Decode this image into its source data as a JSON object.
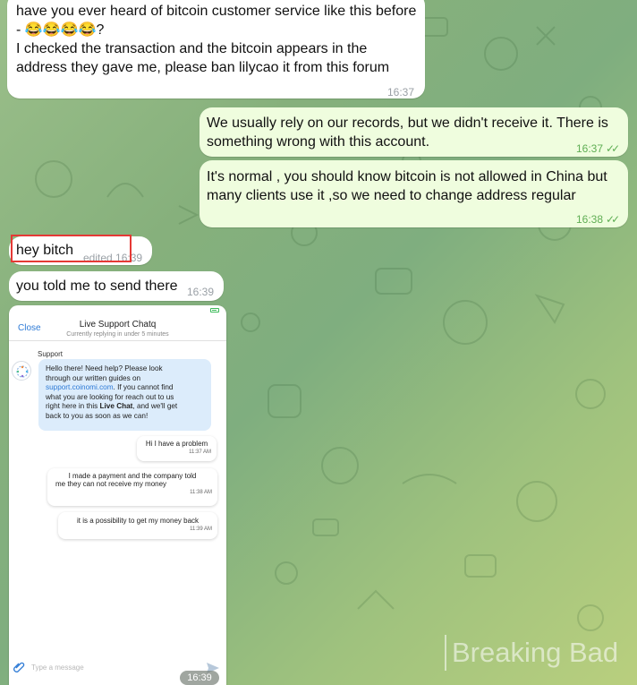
{
  "messages": {
    "first": {
      "line1": "have you ever heard of bitcoin customer service like this before",
      "line2_prefix": "- ",
      "emoji": "😂😂😂😂",
      "line2_suffix": "?",
      "line3": "I checked the transaction and the bitcoin appears in the",
      "line4": "address they gave me, please ban lilycao it from this forum",
      "time": "16:37"
    },
    "out1": {
      "line1": "We usually rely on our records, but we didn't receive it. There is",
      "line2": "something wrong with this account.",
      "time": "16:37",
      "ticks": "✓✓"
    },
    "out2": {
      "line1": "It's normal , you should know bitcoin is not allowed in China but",
      "line2": "many clients use it ,so we need to change address regular",
      "time": "16:38",
      "ticks": "✓✓"
    },
    "hey": {
      "text": "hey bitch",
      "edited": "edited 16:39"
    },
    "told": {
      "text": "you told me to send there",
      "time": "16:39"
    }
  },
  "screenshot": {
    "close": "Close",
    "title": "Live Support Chatq",
    "subtitle": "Currently replying in under 5 minutes",
    "support_label": "Support",
    "support_msg": {
      "l1": "Hello there! Need help? Please look",
      "l2": "through our written guides on",
      "link": "support.coinomi.com",
      "l3_suffix": ". If you cannot find",
      "l4": "what you are looking for reach out to us",
      "l5_prefix": "right here in this ",
      "l5_bold": "Live Chat",
      "l5_suffix": ", and we'll get",
      "l6": "back to you as soon as we can!"
    },
    "user_msgs": [
      {
        "text": "Hi I have a problem",
        "time": "11:37 AM"
      },
      {
        "line1": "I made a payment and the company told",
        "line2": "me they can not receive my money",
        "time": "11:38 AM"
      },
      {
        "text": "it is a possibility to get my money back",
        "time": "11:39 AM"
      }
    ],
    "placeholder": "Type a message",
    "time_badge": "16:39"
  },
  "watermark": "Breaking Bad",
  "colors": {
    "outgoing": "#effdde",
    "incoming": "#ffffff",
    "highlight": "#e53935",
    "link": "#2f7bd6"
  }
}
